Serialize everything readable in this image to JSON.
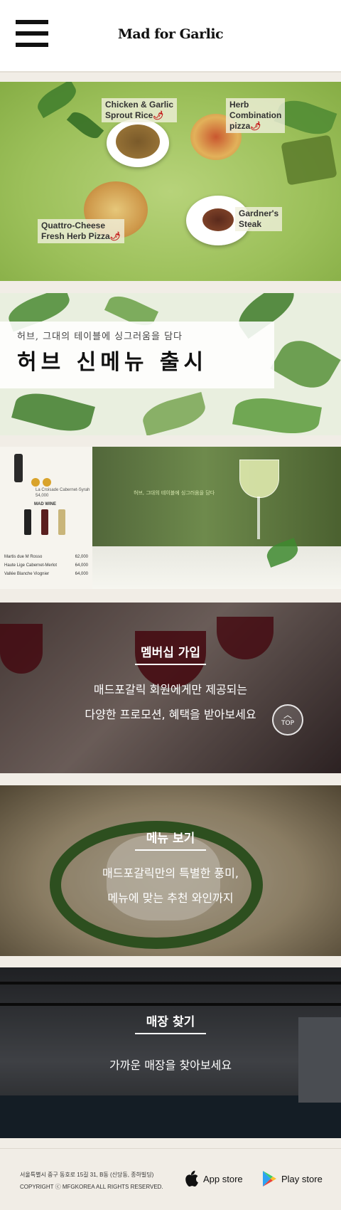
{
  "header": {
    "logo": "Mad for Garlic",
    "menu_icon": "hamburger-menu-icon"
  },
  "banner1": {
    "dishes": [
      {
        "name": "Chicken & Garlic\nSprout Rice",
        "spicy": true
      },
      {
        "name": "Herb\nCombination\npizza",
        "spicy": true
      },
      {
        "name": "Gardner's\nSteak",
        "spicy": false
      },
      {
        "name": "Quattro-Cheese\nFresh Herb Pizza",
        "spicy": true
      }
    ],
    "chili": "🌶"
  },
  "banner2": {
    "subtitle": "허브, 그대의 테이블에 싱그러움을 담다",
    "title": "허브 신메뉴 출시"
  },
  "banner3": {
    "label": "MAD WINE",
    "wines": [
      {
        "name": "Martis due M Rosso",
        "price": "62,000"
      },
      {
        "name": "Haute Lige Cabernet-Merlot",
        "price": "64,000"
      },
      {
        "name": "Vallée Blanche Viognier",
        "price": "64,000"
      }
    ],
    "featured": {
      "name": "La Croisade Cabernet-Syrah",
      "price": "54,000"
    },
    "tagline": "허브, 그대의 테이블에 싱그러움을 담다"
  },
  "membership": {
    "title": "멤버십 가입",
    "line1": "매드포갈릭 회원에게만 제공되는",
    "line2": "다양한 프로모션, 혜택을 받아보세요"
  },
  "menu": {
    "title": "메뉴 보기",
    "line1": "매드포갈릭만의 특별한 풍미,",
    "line2": "메뉴에 맞는 추천 와인까지"
  },
  "store": {
    "title": "매장 찾기",
    "line1": "가까운 매장을 찾아보세요"
  },
  "top_button": {
    "arrow": "︿",
    "label": "TOP"
  },
  "footer": {
    "address": "서울특별시 중구 동호로 15길 31, B동 (신당동, 종하빌딩)",
    "copyright": "COPYRIGHT ⓒ MFGKOREA ALL RIGHTS RESERVED.",
    "appstore": "App store",
    "playstore": "Play store"
  }
}
